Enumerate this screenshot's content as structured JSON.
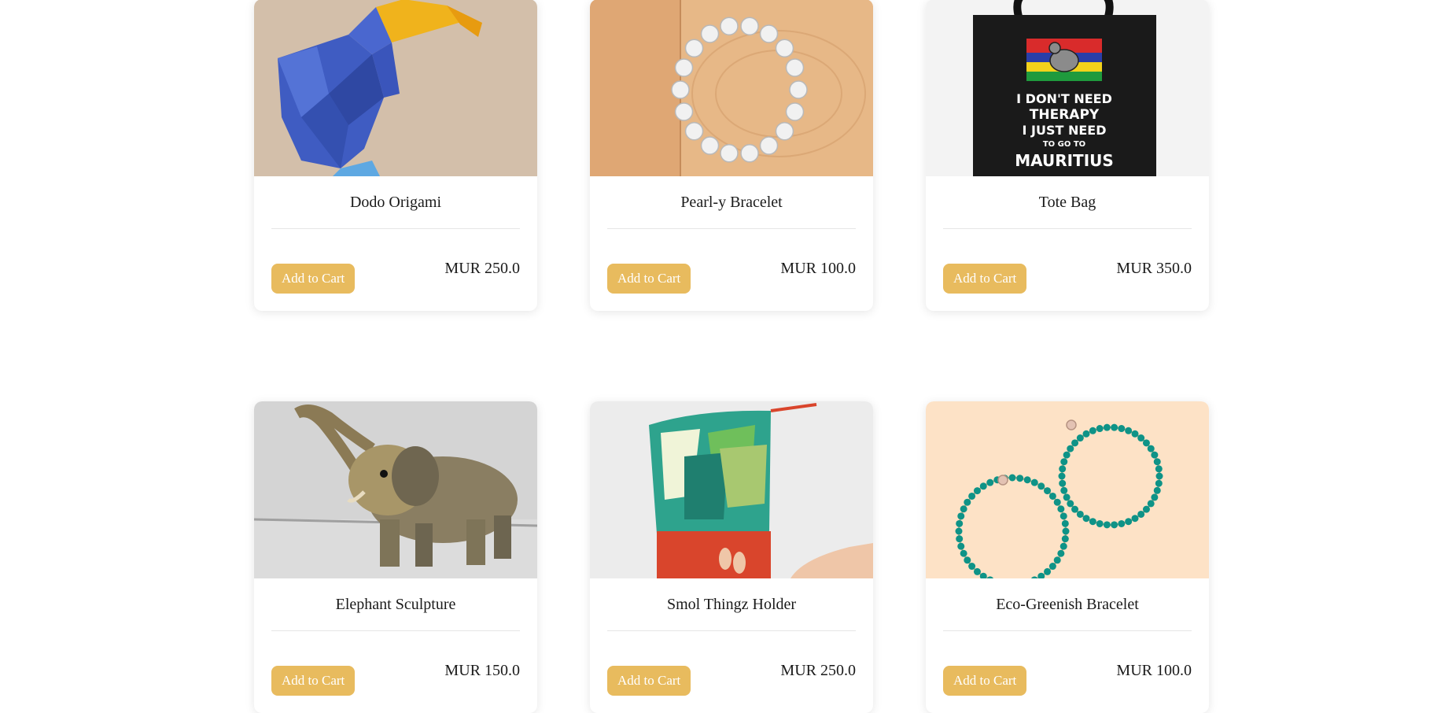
{
  "products": [
    {
      "name": "Dodo Origami",
      "price": "MUR 250.0",
      "button": "Add to Cart",
      "image": "dodo-origami-image"
    },
    {
      "name": "Pearl-y Bracelet",
      "price": "MUR 100.0",
      "button": "Add to Cart",
      "image": "pearl-bracelet-image"
    },
    {
      "name": "Tote Bag",
      "price": "MUR 350.0",
      "button": "Add to Cart",
      "image": "tote-bag-image"
    },
    {
      "name": "Elephant Sculpture",
      "price": "MUR 150.0",
      "button": "Add to Cart",
      "image": "elephant-sculpture-image"
    },
    {
      "name": "Smol Thingz Holder",
      "price": "MUR 250.0",
      "button": "Add to Cart",
      "image": "smol-thingz-holder-image"
    },
    {
      "name": "Eco-Greenish Bracelet",
      "price": "MUR 100.0",
      "button": "Add to Cart",
      "image": "eco-greenish-bracelet-image"
    }
  ],
  "tote_print": {
    "line1": "I DON'T NEED",
    "line2": "THERAPY",
    "line3": "I JUST NEED",
    "line4": "TO GO TO",
    "line5": "MAURITIUS"
  },
  "colors": {
    "button": "#e8bb5e",
    "button_text": "#ffffff"
  }
}
